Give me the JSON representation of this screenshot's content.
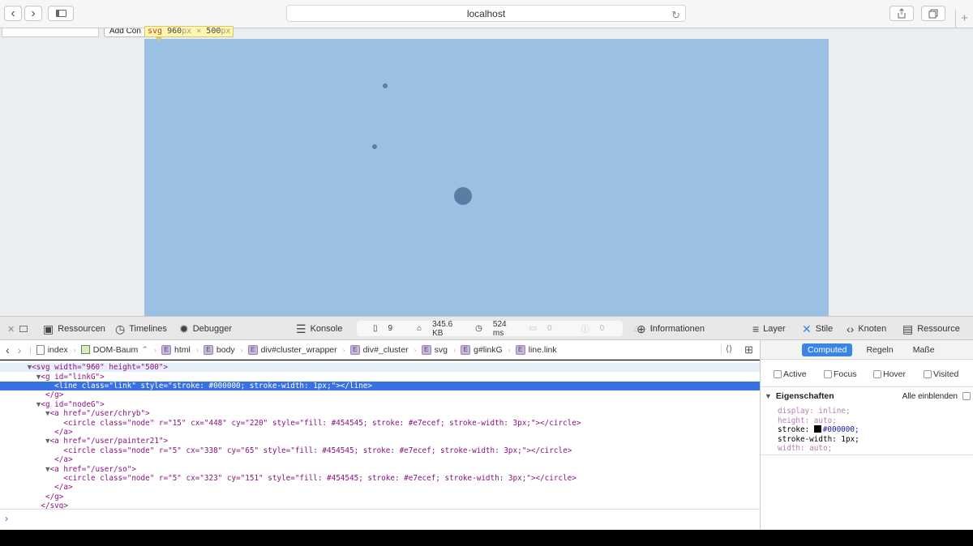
{
  "browser": {
    "url": "localhost",
    "icons": [
      "back-icon",
      "forward-icon",
      "sidebar-icon",
      "reload-icon",
      "share-icon",
      "tabs-icon",
      "new-tab-icon"
    ]
  },
  "page": {
    "button_label": "Add Con",
    "tooltip": {
      "tag": "svg",
      "w": "960",
      "unit": "px",
      "x": "×",
      "h": "500"
    },
    "svg_fill": "#9ac0e3",
    "node_color": "#5a7ea3"
  },
  "devtools": {
    "tabs": {
      "resources": "Ressourcen",
      "timelines": "Timelines",
      "debugger": "Debugger",
      "console": "Konsole",
      "info": "Informationen",
      "layer": "Layer",
      "styles": "Stile",
      "nodes": "Knoten",
      "resource": "Ressource"
    },
    "stats": {
      "documents": "9",
      "size": "345.6 KB",
      "time": "524 ms",
      "logs": "0",
      "errors": "0",
      "warnings": "0"
    },
    "breadcrumbs": [
      "index",
      "DOM-Baum",
      "html",
      "body",
      "div#cluster_wrapper",
      "div#_cluster",
      "svg",
      "g#linkG",
      "line.link"
    ],
    "dom_lines": [
      {
        "indent": 0,
        "text": "<svg width=\"960\" height=\"500\">"
      },
      {
        "indent": 1,
        "text": "<g id=\"linkG\">"
      },
      {
        "indent": 2,
        "text": "<line class=\"link\" style=\"stroke: #000000; stroke-width: 1px;\"></line>"
      },
      {
        "indent": 1,
        "text": "</g>"
      },
      {
        "indent": 1,
        "text": "<g id=\"nodeG\">"
      },
      {
        "indent": 2,
        "text": "<a href=\"/user/chryb\">"
      },
      {
        "indent": 3,
        "text": "<circle class=\"node\" r=\"15\" cx=\"448\" cy=\"220\" style=\"fill: #454545; stroke: #e7ecef; stroke-width: 3px;\"></circle>"
      },
      {
        "indent": 2,
        "text": "</a>"
      },
      {
        "indent": 2,
        "text": "<a href=\"/user/painter21\">"
      },
      {
        "indent": 3,
        "text": "<circle class=\"node\" r=\"5\" cx=\"338\" cy=\"65\" style=\"fill: #454545; stroke: #e7ecef; stroke-width: 3px;\"></circle>"
      },
      {
        "indent": 2,
        "text": "</a>"
      },
      {
        "indent": 2,
        "text": "<a href=\"/user/so\">"
      },
      {
        "indent": 3,
        "text": "<circle class=\"node\" r=\"5\" cx=\"323\" cy=\"151\" style=\"fill: #454545; stroke: #e7ecef; stroke-width: 3px;\"></circle>"
      },
      {
        "indent": 2,
        "text": "</a>"
      },
      {
        "indent": 1,
        "text": "</g>"
      },
      {
        "indent": 0,
        "text": "</svg>"
      }
    ],
    "console_prompt": "›",
    "sidebar": {
      "tabs": [
        "Computed",
        "Regeln",
        "Maße"
      ],
      "pseudo": [
        "Active",
        "Focus",
        "Hover",
        "Visited"
      ],
      "section_title": "Eigenschaften",
      "show_all": "Alle einblenden",
      "props": [
        {
          "name": "display",
          "value": "inline;",
          "grey": true
        },
        {
          "name": "height",
          "value": "auto;",
          "grey": true
        },
        {
          "name": "stroke",
          "value": "#000000;",
          "grey": false,
          "swatch": true
        },
        {
          "name": "stroke-width",
          "value": "1px;",
          "grey": false
        },
        {
          "name": "width",
          "value": "auto;",
          "grey": true
        }
      ]
    }
  }
}
